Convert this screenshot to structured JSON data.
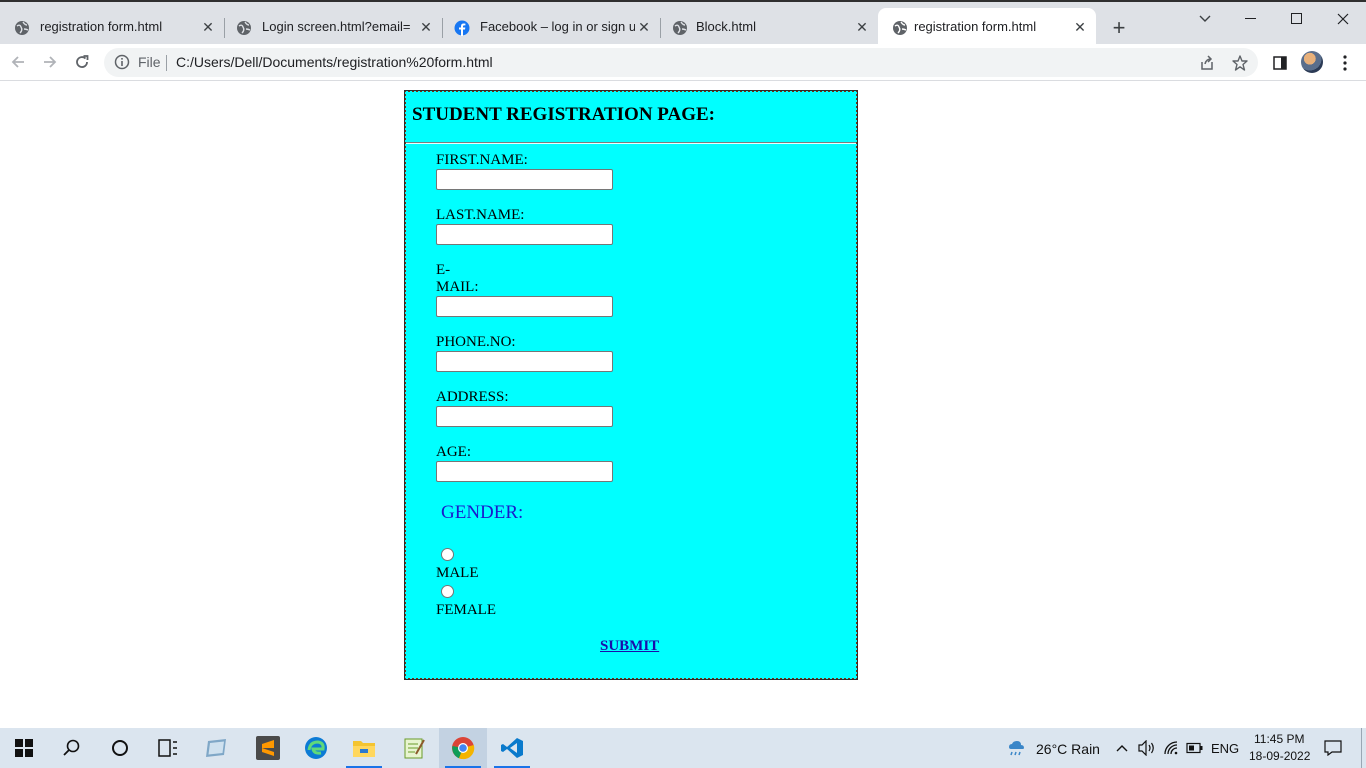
{
  "browser": {
    "tabs": [
      {
        "title": "registration form.html",
        "icon": "globe-icon",
        "active": false
      },
      {
        "title": "Login screen.html?email=&p",
        "icon": "globe-icon",
        "active": false
      },
      {
        "title": "Facebook – log in or sign up",
        "icon": "facebook-icon",
        "active": false
      },
      {
        "title": "Block.html",
        "icon": "globe-icon",
        "active": false
      },
      {
        "title": "registration form.html",
        "icon": "globe-icon",
        "active": true
      }
    ],
    "new_tab_label": "+",
    "scheme_label": "File",
    "url": "C:/Users/Dell/Documents/registration%20form.html"
  },
  "form": {
    "title": "STUDENT REGISTRATION PAGE:",
    "fields": [
      {
        "label": "FIRST.NAME:",
        "value": ""
      },
      {
        "label": "LAST.NAME:",
        "value": ""
      },
      {
        "label_line1": "E-",
        "label_line2": "MAIL:",
        "value": ""
      },
      {
        "label": "PHONE.NO:",
        "value": ""
      },
      {
        "label": "ADDRESS:",
        "value": ""
      },
      {
        "label": "AGE:",
        "value": ""
      }
    ],
    "gender_heading": "GENDER:",
    "gender_options": [
      {
        "label": "MALE",
        "selected": false
      },
      {
        "label": "FEMALE",
        "selected": false
      }
    ],
    "submit_label": "SUBMIT",
    "colors": {
      "background": "#00ffff",
      "gender_heading": "#1a1acc",
      "link": "#1a0dab"
    }
  },
  "taskbar": {
    "weather": "26°C  Rain",
    "language": "ENG",
    "time": "11:45 PM",
    "date": "18-09-2022"
  }
}
